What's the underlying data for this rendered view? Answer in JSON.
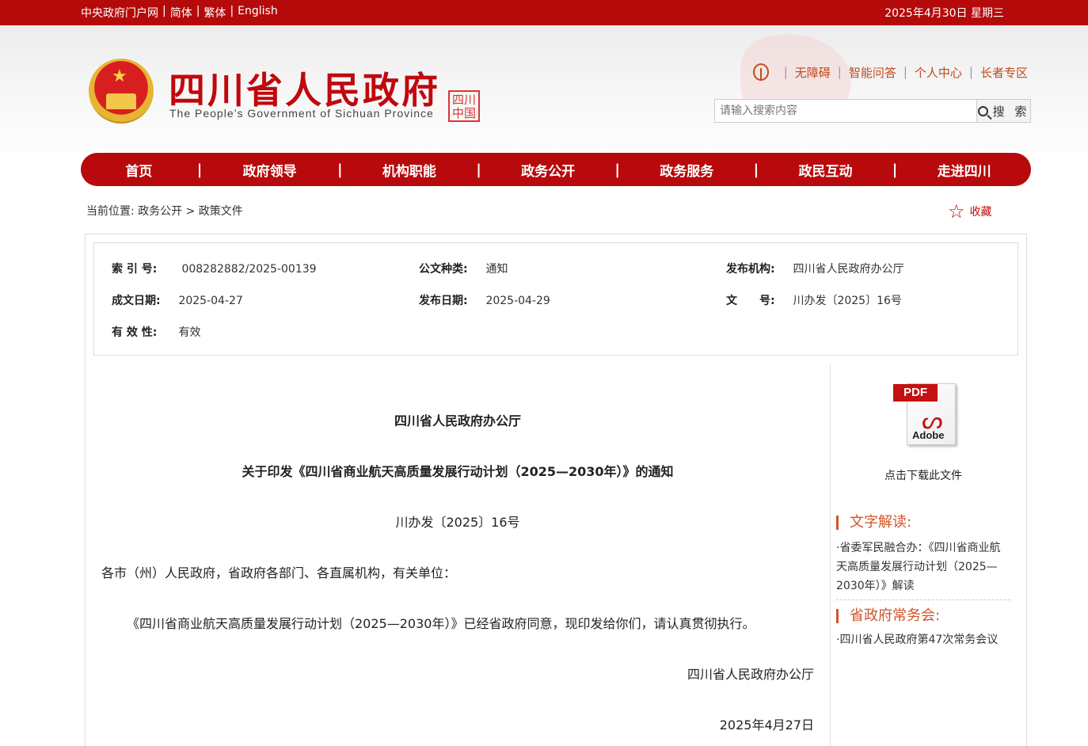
{
  "topbar": {
    "links": [
      "中央政府门户网",
      "简体",
      "繁体",
      "English"
    ],
    "separator": "|",
    "date": "2025年4月30日 星期三"
  },
  "header": {
    "title": "四川省人民政府",
    "subtitle": "The People’s Government of Sichuan Province",
    "seal_text": "四川中国",
    "utility_links": [
      "无障碍",
      "智能问答",
      "个人中心",
      "长者专区"
    ],
    "search_placeholder": "请输入搜索内容",
    "search_button": "搜 索"
  },
  "nav": {
    "items": [
      "首页",
      "政府领导",
      "机构职能",
      "政务公开",
      "政务服务",
      "政民互动",
      "走进四川"
    ],
    "separator": "|"
  },
  "breadcrumb": {
    "prefix": "当前位置:",
    "path": "政务公开 > 政策文件"
  },
  "favorite": {
    "icon": "star-outline-icon",
    "label": "收藏"
  },
  "meta": {
    "index_label": "索 引 号:",
    "index_value": "008282882/2025-00139",
    "type_label": "公文种类:",
    "type_value": "通知",
    "issuer_label": "发布机构:",
    "issuer_value": "四川省人民政府办公厅",
    "created_label": "成文日期:",
    "created_value": "2025-04-27",
    "published_label": "发布日期:",
    "published_value": "2025-04-29",
    "doc_no_label": "文　　号:",
    "doc_no_value": "川办发〔2025〕16号",
    "validity_label": "有 效 性:",
    "validity_value": "有效"
  },
  "article": {
    "issuer": "四川省人民政府办公厅",
    "title": "关于印发《四川省商业航天高质量发展行动计划（2025—2030年）》的通知",
    "doc_number": "川办发〔2025〕16号",
    "salutation": "各市（州）人民政府，省政府各部门、各直属机构，有关单位：",
    "body": "《四川省商业航天高质量发展行动计划（2025—2030年）》已经省政府同意，现印发给你们，请认真贯彻执行。",
    "signature": "四川省人民政府办公厅",
    "date": "2025年4月27日"
  },
  "sidebar": {
    "pdf_tag": "PDF",
    "pdf_brand": "Adobe",
    "download_label": "点击下载此文件",
    "interpret_title": "文字解读:",
    "interpret_item": "·省委军民融合办：《四川省商业航天高质量发展行动计划（2025—2030年）》解读",
    "meeting_title": "省政府常务会:",
    "meeting_item": "·四川省人民政府第47次常务会议"
  },
  "colors": {
    "brand_red": "#b80a0c",
    "accent_orange": "#d2542a"
  }
}
